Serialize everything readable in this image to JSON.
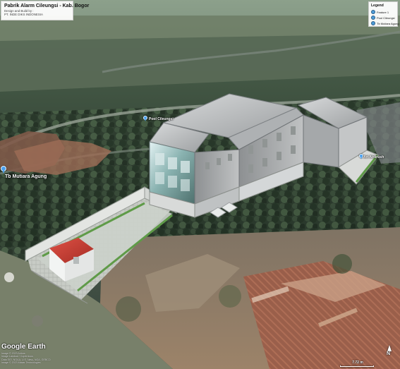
{
  "header": {
    "title": "Pabrik Alarm Cileungsi - Kab. Bogor",
    "subtitle_1": "Design and Build by :",
    "subtitle_2": "PT. INDE DIKS INDONESIA"
  },
  "legend": {
    "title": "Legend",
    "items": [
      {
        "label": "Feature 1",
        "icon": "map-pin-icon"
      },
      {
        "label": "Pool Cileungsi",
        "icon": "map-pin-icon"
      },
      {
        "label": "Tb Mutiara Agung",
        "icon": "map-pin-icon"
      }
    ]
  },
  "map": {
    "labels": {
      "tb_mutiara_agung": "Tb Mutiara Agung",
      "pool_cileungsi": "Pool Cileungsi",
      "art_airbrush": "Art Airbrush"
    },
    "brand": "Google Earth",
    "attribution_1": "Image © 2023 Airbus",
    "attribution_2": "Image Landsat / Copernicus",
    "attribution_3": "Data SIO, NOAA, U.S. Navy, NGA, GEBCO",
    "attribution_4": "Image © 2023 Maxar Technologies",
    "scale_label": "7.72 m",
    "north_label": "N"
  },
  "colors": {
    "pin": "#4aa1f0",
    "roof_red": "#c83c32",
    "building_gray": "#b8babb"
  }
}
